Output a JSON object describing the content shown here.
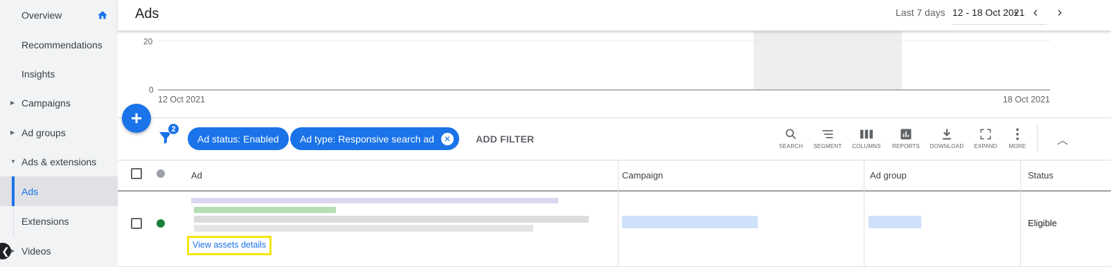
{
  "sidebar": {
    "items": [
      {
        "label": "Overview",
        "icon": "home-icon"
      },
      {
        "label": "Recommendations"
      },
      {
        "label": "Insights"
      },
      {
        "label": "Campaigns"
      },
      {
        "label": "Ad groups"
      },
      {
        "label": "Ads & extensions"
      },
      {
        "label": "Ads"
      },
      {
        "label": "Extensions"
      },
      {
        "label": "Videos"
      }
    ],
    "collapse_glyph": "❮"
  },
  "header": {
    "title": "Ads",
    "date_range_label": "Last 7 days",
    "date_range_value": "12 - 18 Oct 2021"
  },
  "chart": {
    "y_ticks": [
      "20",
      "0"
    ],
    "x_start_label": "12 Oct 2021",
    "x_end_label": "18 Oct 2021"
  },
  "filters": {
    "badge_count": "2",
    "chips": [
      {
        "label": "Ad status: Enabled",
        "removable": false
      },
      {
        "label": "Ad type: Responsive search ad",
        "removable": true
      }
    ],
    "add_filter_label": "ADD FILTER"
  },
  "toolbar": {
    "tools": [
      {
        "label": "SEARCH",
        "icon": "search-icon"
      },
      {
        "label": "SEGMENT",
        "icon": "segment-icon"
      },
      {
        "label": "COLUMNS",
        "icon": "columns-icon"
      },
      {
        "label": "REPORTS",
        "icon": "reports-icon"
      },
      {
        "label": "DOWNLOAD",
        "icon": "download-icon"
      },
      {
        "label": "EXPAND",
        "icon": "expand-icon"
      },
      {
        "label": "MORE",
        "icon": "more-icon"
      }
    ]
  },
  "table": {
    "columns": [
      "Ad",
      "Campaign",
      "Ad group",
      "Status"
    ],
    "rows": [
      {
        "status_color": "#188038",
        "view_assets_label": "View assets details",
        "status": "Eligible"
      }
    ]
  },
  "colors": {
    "accent": "#1a73e8",
    "highlight_border": "#f4e610",
    "enabled_dot": "#188038"
  }
}
